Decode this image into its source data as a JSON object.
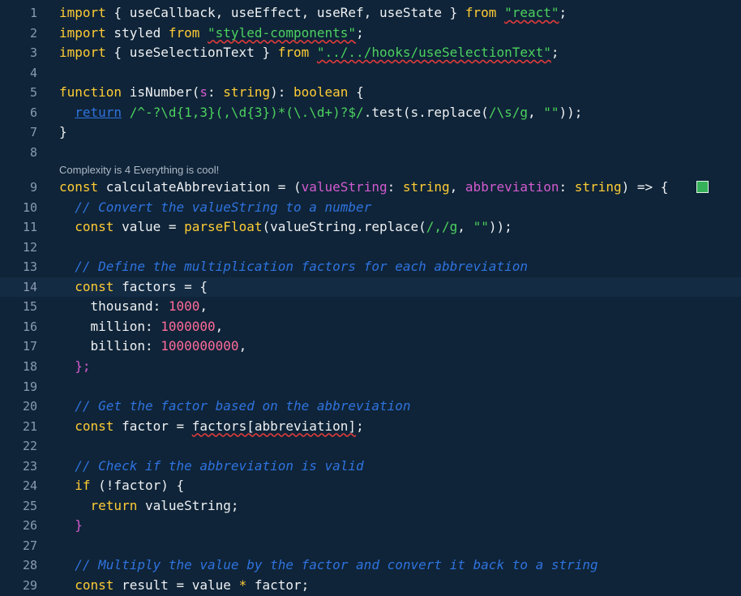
{
  "editor": {
    "code_lens": "Complexity is 4 Everything is cool!",
    "accent_colors": {
      "background": "#0f2438",
      "keyword": "#ffcc35",
      "string": "#4dd15f",
      "comment": "#2f73df",
      "number": "#ff6b9a",
      "regex": "#4dd15f",
      "bracket_pink": "#d25bd0",
      "error_squiggle": "#e03b3b",
      "status_marker": "#35b15a"
    },
    "lines": [
      {
        "n": "1",
        "tokens": [
          [
            "import",
            "kw"
          ],
          [
            " { useCallback, useEffect, useRef, useState } ",
            "id"
          ],
          [
            "from",
            "kw"
          ],
          [
            " ",
            ""
          ],
          [
            "\"react\"",
            "str sq"
          ],
          [
            ";",
            "id"
          ]
        ]
      },
      {
        "n": "2",
        "tokens": [
          [
            "import",
            "kw"
          ],
          [
            " styled ",
            "id"
          ],
          [
            "from",
            "kw"
          ],
          [
            " ",
            ""
          ],
          [
            "\"styled-components\"",
            "str sq"
          ],
          [
            ";",
            "id"
          ]
        ]
      },
      {
        "n": "3",
        "tokens": [
          [
            "import",
            "kw"
          ],
          [
            " { useSelectionText } ",
            "id"
          ],
          [
            "from",
            "kw"
          ],
          [
            " ",
            ""
          ],
          [
            "\"../../hooks/useSelectionText\"",
            "str sq"
          ],
          [
            ";",
            "id"
          ]
        ]
      },
      {
        "n": "4",
        "tokens": []
      },
      {
        "n": "5",
        "tokens": [
          [
            "function",
            "kw"
          ],
          [
            " isNumber(",
            "id"
          ],
          [
            "s",
            "param"
          ],
          [
            ": ",
            "id"
          ],
          [
            "string",
            "type"
          ],
          [
            "): ",
            "id"
          ],
          [
            "boolean",
            "type"
          ],
          [
            " {",
            "id"
          ]
        ]
      },
      {
        "n": "6",
        "tokens": [
          [
            "  ",
            ""
          ],
          [
            "return",
            "kw2"
          ],
          [
            " ",
            ""
          ],
          [
            "/^-?\\d{1,3}(,\\d{3})*(\\.\\d+)?$/",
            "re"
          ],
          [
            ".test(s.replace(",
            "id"
          ],
          [
            "/\\s/g",
            "re"
          ],
          [
            ", ",
            "id"
          ],
          [
            "\"\"",
            "str"
          ],
          [
            "));",
            "id"
          ]
        ]
      },
      {
        "n": "7",
        "tokens": [
          [
            "}",
            "id"
          ]
        ]
      },
      {
        "n": "8",
        "tokens": []
      },
      {
        "n": "9",
        "tokens": [
          [
            "const",
            "kw"
          ],
          [
            " calculateAbbreviation = (",
            "id"
          ],
          [
            "valueString",
            "param"
          ],
          [
            ": ",
            "id"
          ],
          [
            "string",
            "type"
          ],
          [
            ", ",
            "id"
          ],
          [
            "abbreviation",
            "param"
          ],
          [
            ": ",
            "id"
          ],
          [
            "string",
            "type"
          ],
          [
            ") => {",
            "id"
          ]
        ]
      },
      {
        "n": "10",
        "tokens": [
          [
            "  ",
            ""
          ],
          [
            "// Convert the valueString to a number",
            "cm"
          ]
        ]
      },
      {
        "n": "11",
        "tokens": [
          [
            "  ",
            ""
          ],
          [
            "const",
            "kw"
          ],
          [
            " value = ",
            "id"
          ],
          [
            "parseFloat",
            "fn"
          ],
          [
            "(valueString.replace(",
            "id"
          ],
          [
            "/,/g",
            "re"
          ],
          [
            ", ",
            "id"
          ],
          [
            "\"\"",
            "str"
          ],
          [
            "));",
            "id"
          ]
        ]
      },
      {
        "n": "12",
        "tokens": []
      },
      {
        "n": "13",
        "tokens": [
          [
            "  ",
            ""
          ],
          [
            "// Define the multiplication factors for each abbreviation",
            "cm"
          ]
        ]
      },
      {
        "n": "14",
        "tokens": [
          [
            "  ",
            ""
          ],
          [
            "const",
            "kw"
          ],
          [
            " factors = {",
            "id"
          ]
        ]
      },
      {
        "n": "15",
        "tokens": [
          [
            "    thousand: ",
            "id"
          ],
          [
            "1000",
            "num"
          ],
          [
            ",",
            "id"
          ]
        ]
      },
      {
        "n": "16",
        "tokens": [
          [
            "    million: ",
            "id"
          ],
          [
            "1000000",
            "num"
          ],
          [
            ",",
            "id"
          ]
        ]
      },
      {
        "n": "17",
        "tokens": [
          [
            "    billion: ",
            "id"
          ],
          [
            "1000000000",
            "num"
          ],
          [
            ",",
            "id"
          ]
        ]
      },
      {
        "n": "18",
        "tokens": [
          [
            "  ",
            ""
          ],
          [
            "};",
            "br"
          ]
        ]
      },
      {
        "n": "19",
        "tokens": []
      },
      {
        "n": "20",
        "tokens": [
          [
            "  ",
            ""
          ],
          [
            "// Get the factor based on the abbreviation",
            "cm"
          ]
        ]
      },
      {
        "n": "21",
        "tokens": [
          [
            "  ",
            ""
          ],
          [
            "const",
            "kw"
          ],
          [
            " factor = ",
            "id"
          ],
          [
            "factors[abbreviation]",
            "id sq"
          ],
          [
            ";",
            "id"
          ]
        ]
      },
      {
        "n": "22",
        "tokens": []
      },
      {
        "n": "23",
        "tokens": [
          [
            "  ",
            ""
          ],
          [
            "// Check if the abbreviation is valid",
            "cm"
          ]
        ]
      },
      {
        "n": "24",
        "tokens": [
          [
            "  ",
            ""
          ],
          [
            "if",
            "kw"
          ],
          [
            " (!factor) {",
            "id"
          ]
        ]
      },
      {
        "n": "25",
        "tokens": [
          [
            "    ",
            ""
          ],
          [
            "return",
            "kw"
          ],
          [
            " valueString;",
            "id"
          ]
        ]
      },
      {
        "n": "26",
        "tokens": [
          [
            "  ",
            ""
          ],
          [
            "}",
            "br"
          ]
        ]
      },
      {
        "n": "27",
        "tokens": []
      },
      {
        "n": "28",
        "tokens": [
          [
            "  ",
            ""
          ],
          [
            "// Multiply the value by the factor and convert it back to a string",
            "cm"
          ]
        ]
      },
      {
        "n": "29",
        "tokens": [
          [
            "  ",
            ""
          ],
          [
            "const",
            "kw"
          ],
          [
            " result = value ",
            "id"
          ],
          [
            "*",
            "kw"
          ],
          [
            " factor;",
            "id"
          ]
        ]
      }
    ]
  }
}
